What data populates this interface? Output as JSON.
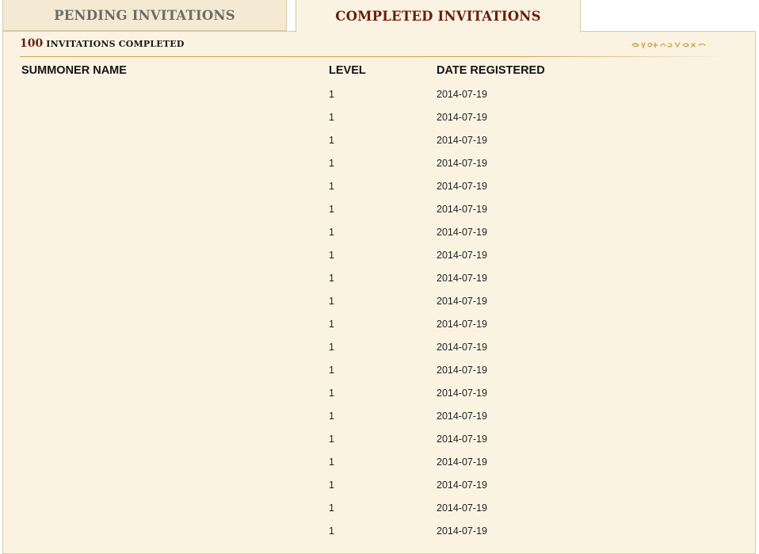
{
  "tabs": {
    "pending_label": "PENDING INVITATIONS",
    "completed_label": "COMPLETED INVITATIONS",
    "active": "completed"
  },
  "summary": {
    "count": "100",
    "label": "INVITATIONS COMPLETED"
  },
  "table": {
    "columns": [
      "SUMMONER NAME",
      "LEVEL",
      "DATE REGISTERED"
    ],
    "rows": [
      {
        "name": "",
        "level": "1",
        "date": "2014-07-19"
      },
      {
        "name": "",
        "level": "1",
        "date": "2014-07-19"
      },
      {
        "name": "",
        "level": "1",
        "date": "2014-07-19"
      },
      {
        "name": "",
        "level": "1",
        "date": "2014-07-19"
      },
      {
        "name": "",
        "level": "1",
        "date": "2014-07-19"
      },
      {
        "name": "",
        "level": "1",
        "date": "2014-07-19"
      },
      {
        "name": "",
        "level": "1",
        "date": "2014-07-19"
      },
      {
        "name": "",
        "level": "1",
        "date": "2014-07-19"
      },
      {
        "name": "",
        "level": "1",
        "date": "2014-07-19"
      },
      {
        "name": "",
        "level": "1",
        "date": "2014-07-19"
      },
      {
        "name": "",
        "level": "1",
        "date": "2014-07-19"
      },
      {
        "name": "",
        "level": "1",
        "date": "2014-07-19"
      },
      {
        "name": "",
        "level": "1",
        "date": "2014-07-19"
      },
      {
        "name": "",
        "level": "1",
        "date": "2014-07-19"
      },
      {
        "name": "",
        "level": "1",
        "date": "2014-07-19"
      },
      {
        "name": "",
        "level": "1",
        "date": "2014-07-19"
      },
      {
        "name": "",
        "level": "1",
        "date": "2014-07-19"
      },
      {
        "name": "",
        "level": "1",
        "date": "2014-07-19"
      },
      {
        "name": "",
        "level": "1",
        "date": "2014-07-19"
      },
      {
        "name": "",
        "level": "1",
        "date": "2014-07-19"
      }
    ]
  },
  "colors": {
    "panel_bg": "#fbf3e2",
    "tab_inactive_bg": "#f4ead3",
    "accent_red": "#6b1e0c",
    "gold": "#c9a24c",
    "border": "#d8c9a6"
  },
  "icons": {
    "flourish": "ornamental-flourish-icon"
  }
}
